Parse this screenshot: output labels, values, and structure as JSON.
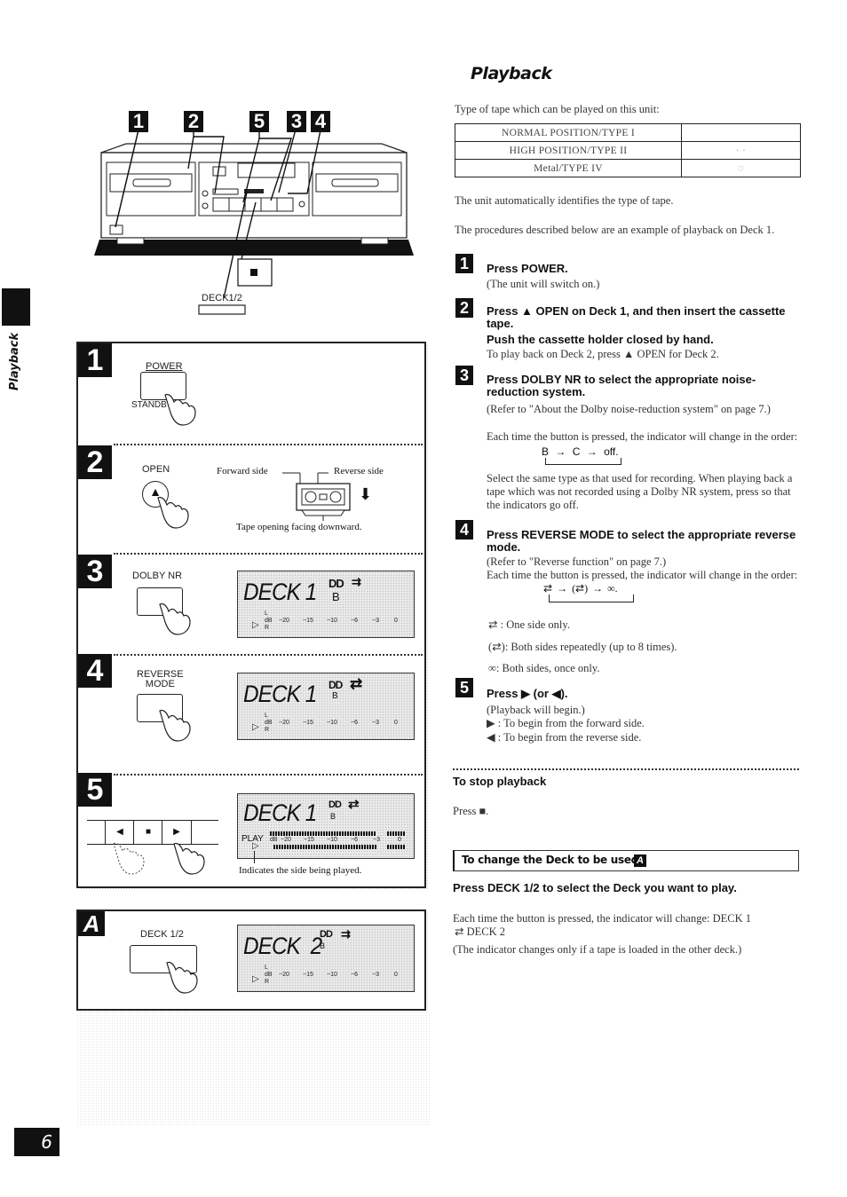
{
  "page": {
    "section_tab_label": "Playback",
    "page_number": "6",
    "title": "Playback"
  },
  "tape_types": {
    "intro": "Type of tape which can be played on this unit:",
    "rows": [
      {
        "name": "NORMAL POSITION/TYPE I",
        "mark": ""
      },
      {
        "name": "HIGH POSITION/TYPE II",
        "mark": "· ·"
      },
      {
        "name": "Metal/TYPE IV",
        "mark": "◌"
      }
    ],
    "auto_note": "The unit automatically identifies the type of tape.",
    "example_note": "The procedures described below are an example of playback on Deck 1."
  },
  "steps": [
    {
      "num": "1",
      "heading": "Press POWER.",
      "lines": [
        "(The unit will switch on.)"
      ]
    },
    {
      "num": "2",
      "heading": "Press ▲ OPEN on Deck 1, and then insert the cassette tape.",
      "subheading": "Push the cassette holder closed by hand.",
      "lines": [
        "To play back on Deck 2, press ▲ OPEN for Deck 2."
      ]
    },
    {
      "num": "3",
      "heading": "Press DOLBY NR to select the appropriate noise-reduction system.",
      "lines": [
        "(Refer to \"About the Dolby noise-reduction system\" on page 7.)",
        "Each time the button is pressed, the indicator will change in the order:"
      ],
      "order": [
        "B",
        "→",
        "C",
        "→",
        "off."
      ],
      "note": "Select the same type as that used for recording. When playing back a tape which was not recorded using a Dolby NR system, press so that the indicators go off."
    },
    {
      "num": "4",
      "heading": "Press REVERSE MODE to select the appropriate reverse mode.",
      "lines": [
        "(Refer to \"Reverse function\" on page 7.)",
        "Each time the button is pressed, the indicator will change in the order:"
      ],
      "order": [
        "⇄",
        "→",
        "(⇄)",
        "→",
        "∞."
      ],
      "modes": [
        {
          "icon": "⇄",
          "text": ": One side only."
        },
        {
          "icon": "(⇄)",
          "text": ": Both sides repeatedly (up to 8 times)."
        },
        {
          "icon": "∞",
          "text": ": Both sides, once only."
        }
      ]
    },
    {
      "num": "5",
      "heading": "Press ▶ (or ◀).",
      "lines": [
        "(Playback will begin.)",
        "▶ : To begin from the forward side.",
        "◀ : To begin from the reverse side."
      ]
    }
  ],
  "stop": {
    "heading": "To stop playback",
    "text": "Press ■."
  },
  "change_deck": {
    "box_title": "To change the Deck to be used",
    "box_badge": "A",
    "heading": "Press DECK 1/2 to select the Deck you want to play.",
    "text1": "Each time the button is pressed, the indicator will change: DECK 1",
    "text2": "⇄ DECK 2",
    "note": "(The indicator changes only if a tape is loaded in the other deck.)"
  },
  "diagram": {
    "callouts": [
      "1",
      "2",
      "5",
      "3",
      "4"
    ],
    "stop_symbol": "■",
    "deck_label": "DECK1/2"
  },
  "panels": {
    "p1": {
      "num": "1",
      "top_label": "POWER",
      "bottom_label": "STANDBY"
    },
    "p2": {
      "num": "2",
      "button_label": "OPEN",
      "button_symbol": "▲",
      "forward": "Forward side",
      "reverse": "Reverse side",
      "caption": "Tape opening facing downward.",
      "arrow": "⬇"
    },
    "p3": {
      "num": "3",
      "button_label": "DOLBY NR",
      "lcd": {
        "deck": "DECK 1",
        "dolby": "DD",
        "nr": "B",
        "mode": "⇉"
      }
    },
    "p4": {
      "num": "4",
      "button_label": "REVERSE",
      "button_label2": "MODE",
      "lcd": {
        "deck": "DECK 1",
        "dolby": "DD",
        "nr": "B",
        "mode": "⇄"
      }
    },
    "p5": {
      "num": "5",
      "buttons": [
        "◀",
        "■",
        "▶"
      ],
      "lcd": {
        "deck": "DECK 1",
        "dolby": "DD",
        "nr": "B",
        "mode": "⇄",
        "status": "PLAY"
      },
      "caption": "Indicates the side being played."
    },
    "pA": {
      "num": "A",
      "button_label": "DECK 1/2",
      "lcd": {
        "deck": "DECK  2",
        "dolby": "DD",
        "nr": "B",
        "mode": "⇉"
      }
    }
  },
  "meter": {
    "l": "L",
    "r": "R",
    "db": "dB",
    "scale": [
      "−20",
      "−15",
      "−10",
      "−6",
      "−3",
      "0"
    ],
    "play_arrow": "▷"
  }
}
